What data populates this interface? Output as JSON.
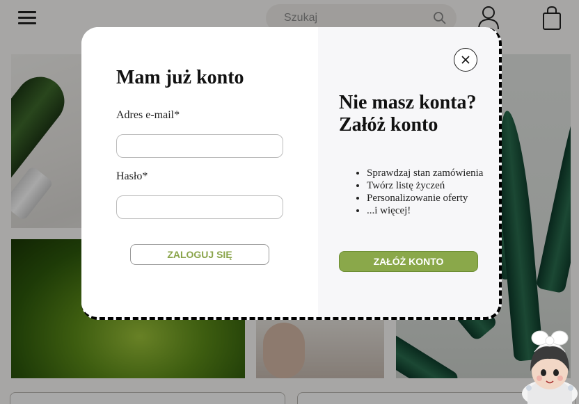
{
  "header": {
    "search_placeholder": "Szukaj",
    "icons": [
      "hamburger-icon",
      "search-icon",
      "user-icon",
      "shopping-bag-icon"
    ]
  },
  "login": {
    "title": "Mam już konto",
    "email_label": "Adres e-mail*",
    "email_value": "",
    "password_label": "Hasło*",
    "password_value": "",
    "submit_label": "ZALOGUJ SIĘ"
  },
  "register": {
    "title_line1": "Nie masz konta?",
    "title_line2": "Załóż konto",
    "benefits": [
      "Sprawdzaj stan zamówienia",
      "Twórz listę życzeń",
      "Personalizowanie oferty",
      "...i więcej!"
    ],
    "submit_label": "ZAŁÓŻ KONTO"
  },
  "colors": {
    "accent_green": "#8aa84a",
    "login_text_green": "#8aa44a",
    "overlay": "rgba(0,0,0,0.34)"
  }
}
